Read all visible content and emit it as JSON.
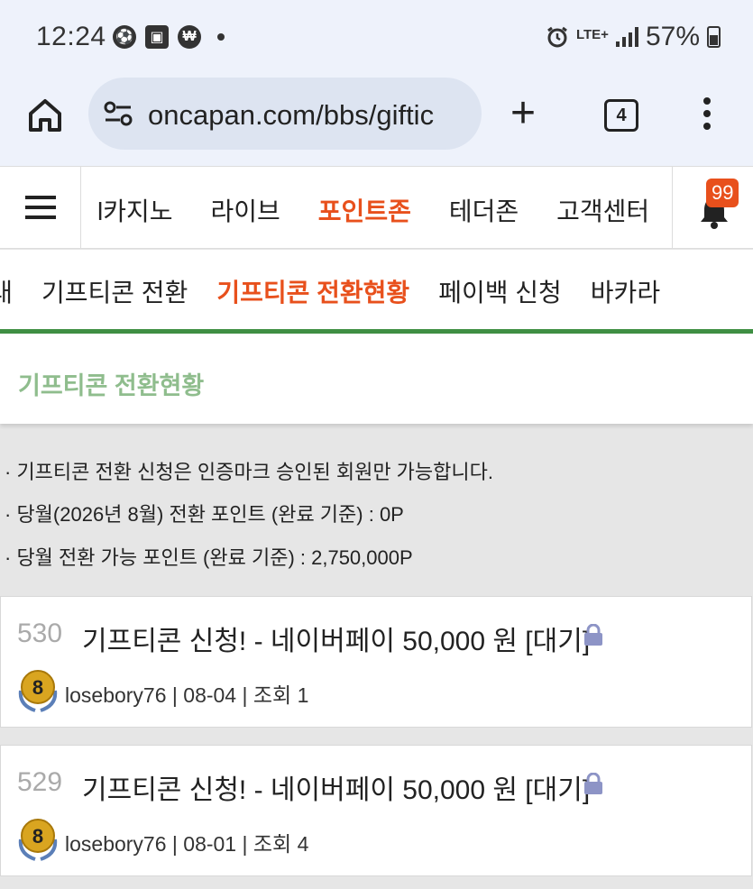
{
  "status_bar": {
    "time": "12:24",
    "network": "LTE+",
    "battery": "57%"
  },
  "browser": {
    "url": "oncapan.com/bbs/giftic",
    "tab_count": "4"
  },
  "main_nav": {
    "items": [
      "l카지노",
      "라이브",
      "포인트존",
      "테더존",
      "고객센터"
    ],
    "active_index": 2,
    "notification_count": "99"
  },
  "sub_nav": {
    "items": [
      "l래",
      "기프티콘 전환",
      "기프티콘 전환현황",
      "페이백 신청",
      "바카라"
    ],
    "active_index": 2
  },
  "page_title": "기프티콘 전환현황",
  "notices": [
    "· 기프티콘 전환 신청은 인증마크 승인된 회원만 가능합니다.",
    "· 당월(2026년 8월) 전환 포인트 (완료 기준) : 0P",
    "· 당월 전환 가능 포인트 (완료 기준) : 2,750,000P"
  ],
  "posts": [
    {
      "number": "530",
      "title": "기프티콘 신청! - 네이버페이 50,000 원 [대기]",
      "level": "8",
      "meta": "losebory76 | 08-04 | 조회 1"
    },
    {
      "number": "529",
      "title": "기프티콘 신청! - 네이버페이 50,000 원 [대기]",
      "level": "8",
      "meta": "losebory76 | 08-01 | 조회 4"
    }
  ],
  "colors": {
    "accent": "#e8501c",
    "title_green": "#8fbd8d",
    "divider_green": "#3f8f43",
    "lock": "#8d94c6"
  }
}
